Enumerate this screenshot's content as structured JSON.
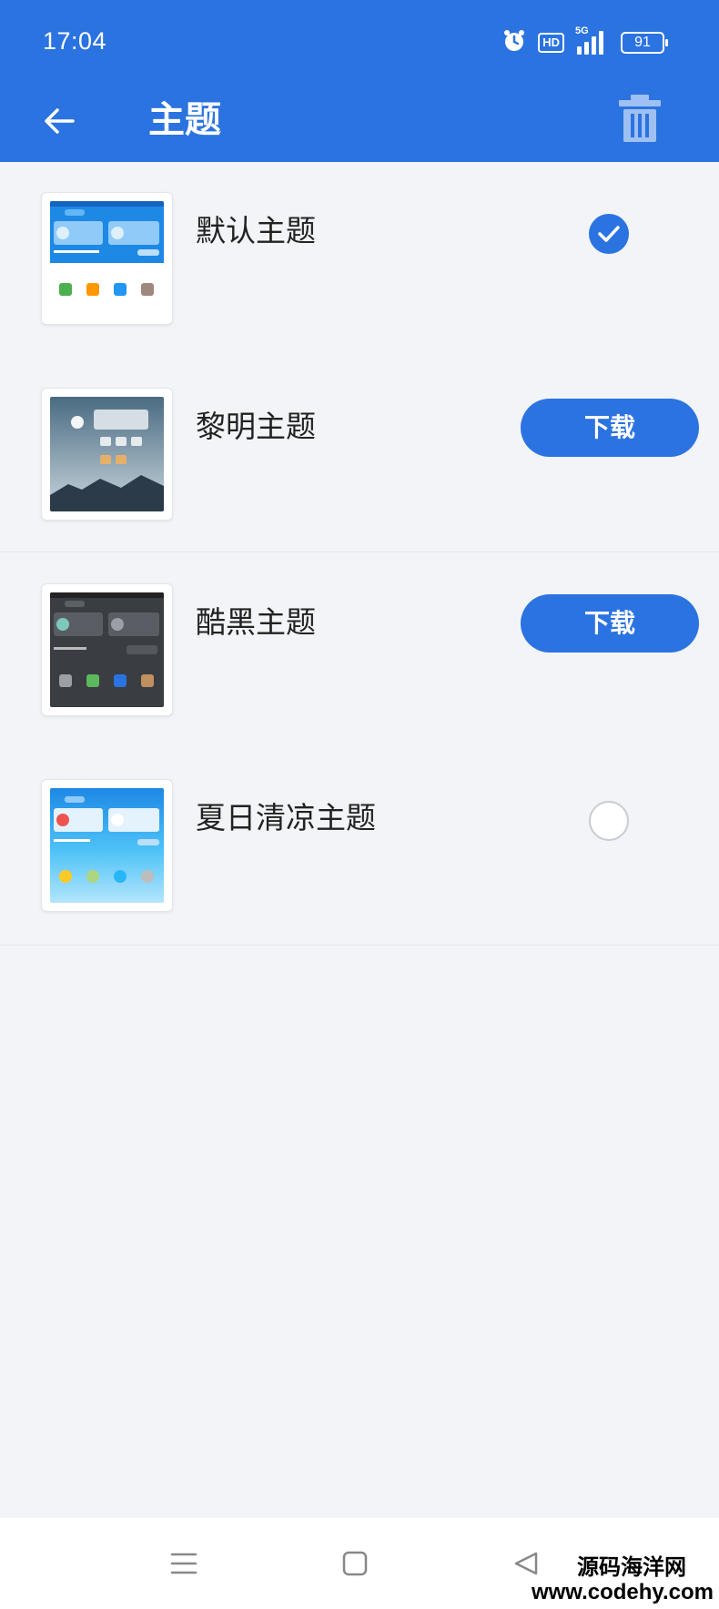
{
  "status_bar": {
    "time": "17:04",
    "network": "5G",
    "hd_badge": "HD",
    "battery": "91",
    "icons": [
      "alarm-icon",
      "hd-icon",
      "signal-icon",
      "battery-icon"
    ]
  },
  "app_bar": {
    "title": "主题",
    "back_icon": "arrow-left-icon",
    "delete_icon": "trash-icon"
  },
  "themes": [
    {
      "name": "默认主题",
      "state": "selected"
    },
    {
      "name": "黎明主题",
      "state": "download",
      "action_label": "下载"
    },
    {
      "name": "酷黑主题",
      "state": "download",
      "action_label": "下载"
    },
    {
      "name": "夏日清凉主题",
      "state": "unselected"
    }
  ],
  "nav_bar": {
    "buttons": [
      "menu-icon",
      "home-icon",
      "back-triangle-icon"
    ]
  },
  "watermark": {
    "site_name": "源码海洋网",
    "url": "www.codehy.com"
  },
  "colors": {
    "primary": "#2b73e0",
    "background": "#f2f4f7",
    "surface": "#ffffff",
    "divider": "#e3e6eb"
  }
}
